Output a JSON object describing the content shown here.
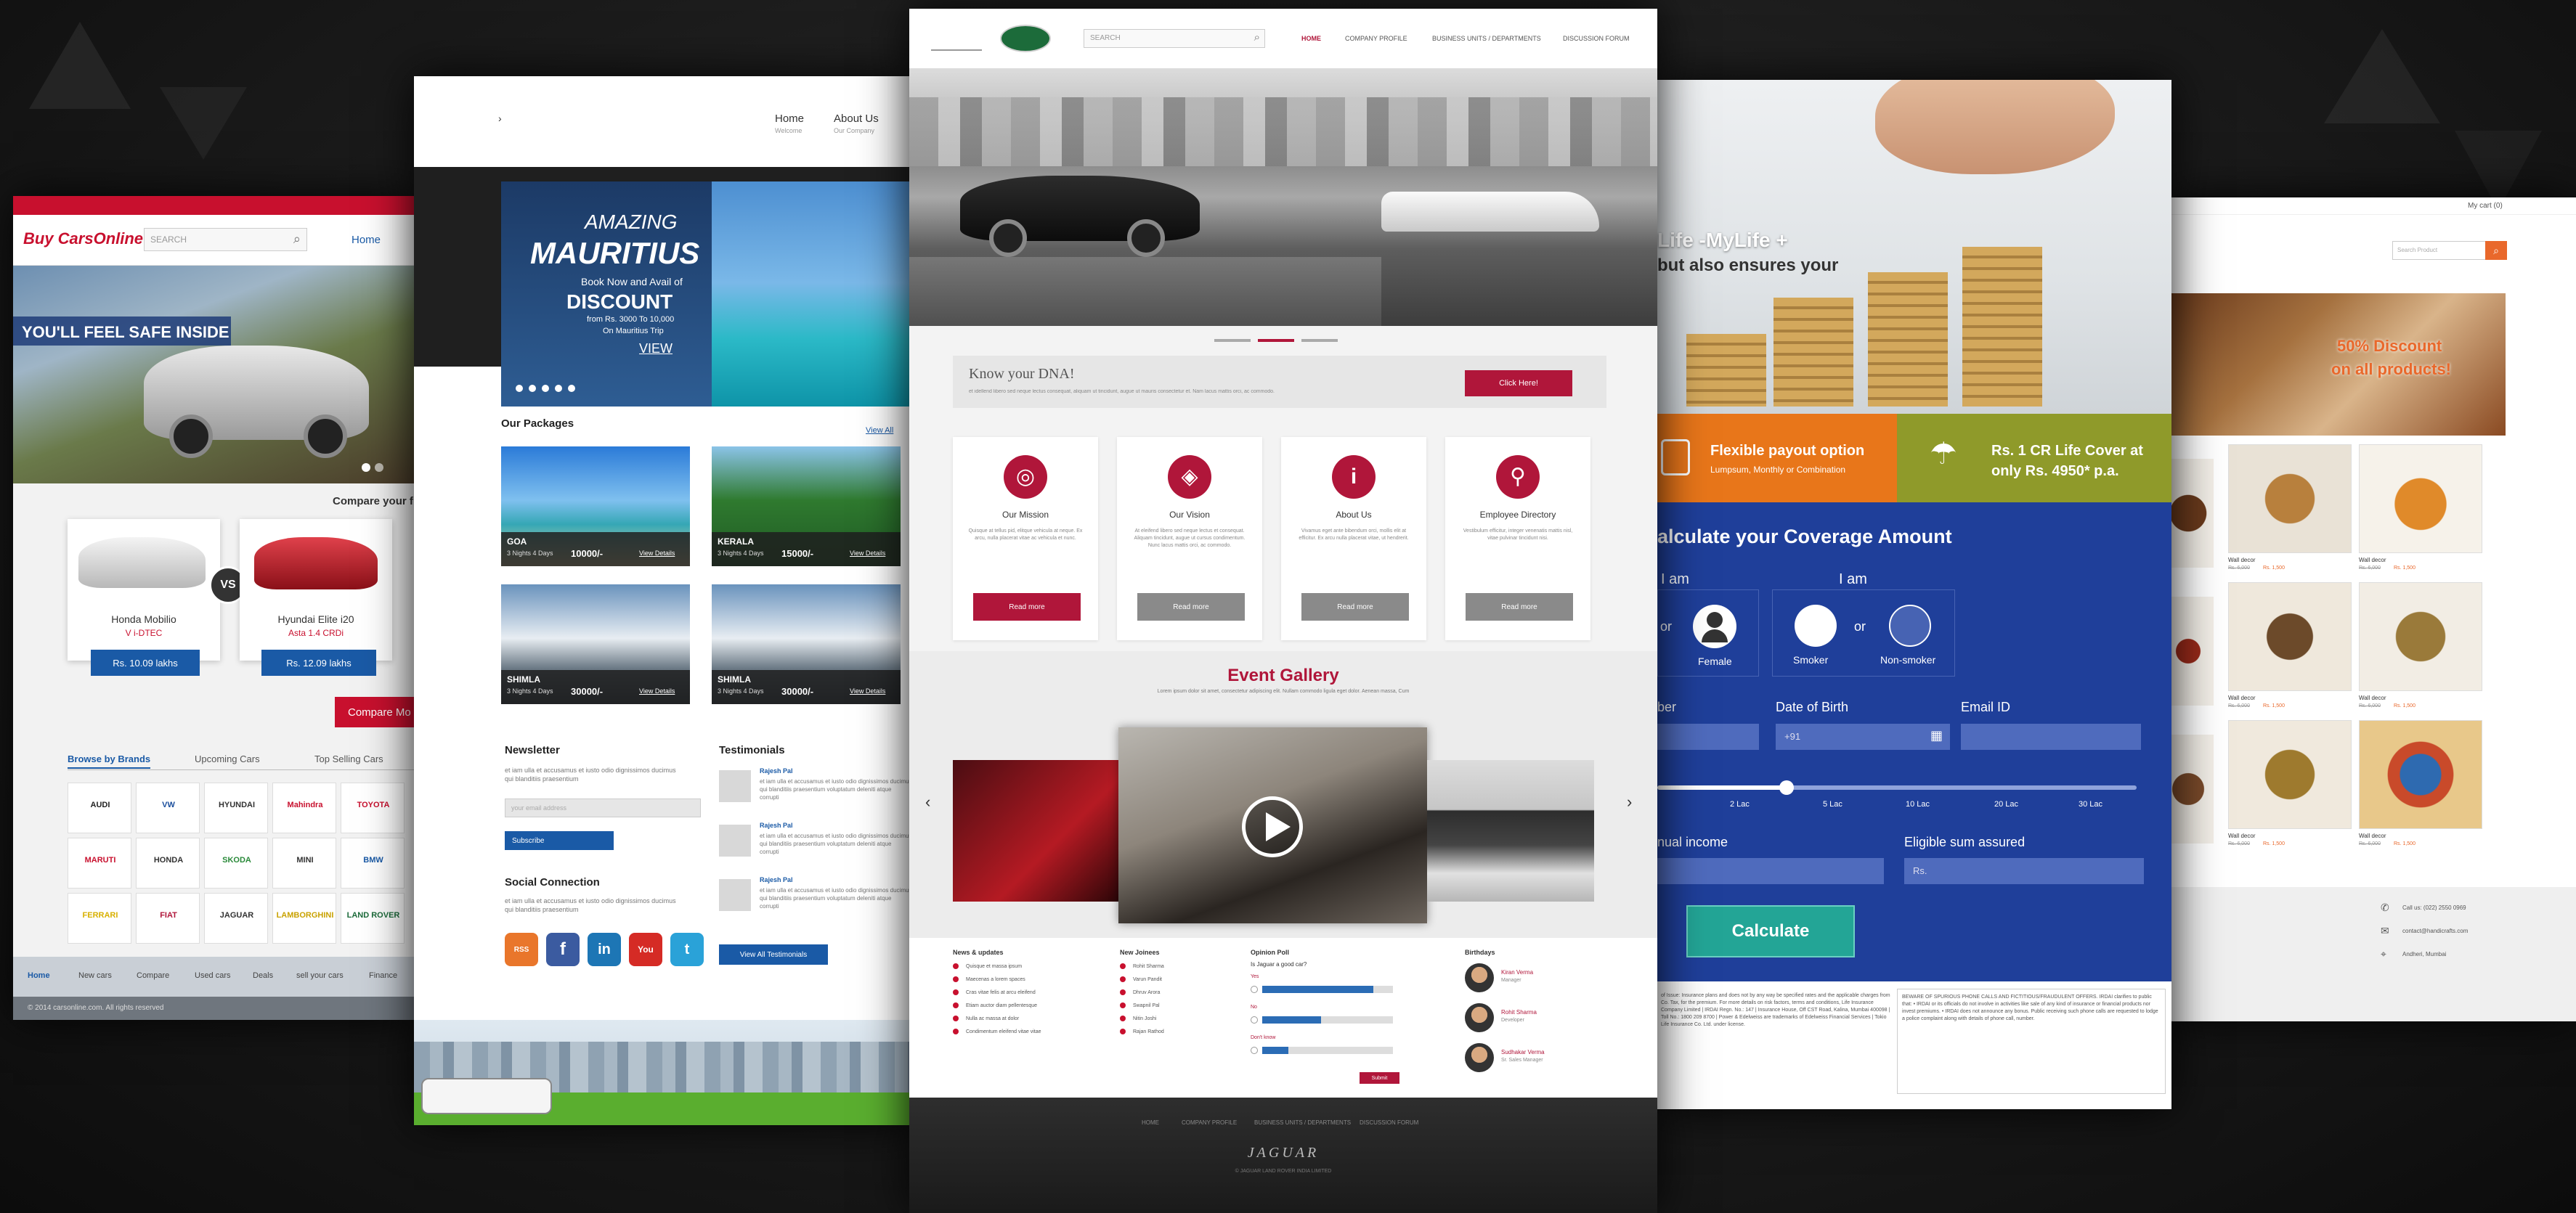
{
  "cars_site": {
    "logo": "Buy CarsOnline",
    "search_placeholder": "SEARCH",
    "nav": [
      "Home"
    ],
    "hero_tagline": "YOU'LL FEEL SAFE INSIDE",
    "compare_heading": "Compare your f",
    "car_a_name": "Honda Mobilio",
    "car_a_variant": "V i-DTEC",
    "car_a_price": "Rs. 10.09 lakhs",
    "car_b_name": "Hyundai Elite i20",
    "car_b_variant": "Asta 1.4 CRDi",
    "car_b_price": "Rs. 12.09 lakhs",
    "vs": "VS",
    "compare_button": "Compare Mo",
    "tabs": [
      "Browse by Brands",
      "Upcoming Cars",
      "Top Selling Cars"
    ],
    "brands": [
      "AUDI",
      "VW",
      "HYUNDAI",
      "Mahindra",
      "TOYOTA",
      "MARUTI",
      "HONDA",
      "SKODA",
      "MINI",
      "BMW",
      "FERRARI",
      "FIAT",
      "JAGUAR",
      "LAMBORGHINI",
      "LAND ROVER"
    ],
    "footer_links": [
      "Home",
      "New cars",
      "Compare",
      "Used cars",
      "Deals",
      "sell your cars",
      "Finance"
    ],
    "copyright": "© 2014 carsonline.com. All rights reserved"
  },
  "holiday_site": {
    "nav": [
      {
        "label": "Home",
        "sub": "Welcome"
      },
      {
        "label": "About Us",
        "sub": "Our Company"
      }
    ],
    "hero_line1": "AMAZING",
    "hero_line2": "MAURITIUS",
    "hero_line3": "Book Now and Avail of",
    "hero_line4": "DISCOUNT",
    "hero_line5": "from Rs. 3000 To 10,000",
    "hero_line6": "On Mauritius Trip",
    "hero_cta": "VIEW",
    "packages_title": "Our Packages",
    "view_all": "View All",
    "packages": [
      {
        "name": "GOA",
        "nights": "3 Nights 4 Days",
        "price": "10000/-",
        "link": "View Details"
      },
      {
        "name": "KERALA",
        "nights": "3 Nights 4 Days",
        "price": "15000/-",
        "link": "View Details"
      },
      {
        "name": "SHIMLA",
        "nights": "3 Nights 4 Days",
        "price": "30000/-",
        "link": "View Details"
      },
      {
        "name": "SHIMLA",
        "nights": "3 Nights 4 Days",
        "price": "30000/-",
        "link": "View Details"
      }
    ],
    "newsletter_title": "Newsletter",
    "newsletter_text": "et iam ulla et accusamus et iusto odio dignissimos ducimus qui blanditiis praesentium",
    "email_placeholder": "your email address",
    "subscribe": "Subscribe",
    "social_title": "Social Connection",
    "social_text": "et iam ulla et accusamus et iusto odio dignissimos ducimus qui blanditiis praesentium",
    "social_icons": [
      "RSS",
      "f",
      "in",
      "You",
      "t"
    ],
    "testimonials_title": "Testimonials",
    "testimonials": [
      {
        "name": "Rajesh Pal",
        "text": "et iam ulla et accusamus et iusto odio dignissimos ducimus qui blanditiis praesentium voluptatum deleniti atque corrupti"
      },
      {
        "name": "Rajesh Pal",
        "text": "et iam ulla et accusamus et iusto odio dignissimos ducimus qui blanditiis praesentium voluptatum deleniti atque corrupti"
      },
      {
        "name": "Rajesh Pal",
        "text": "et iam ulla et accusamus et iusto odio dignissimos ducimus qui blanditiis praesentium voluptatum deleniti atque corrupti"
      }
    ],
    "view_all_testimonials": "View All Testimonials"
  },
  "jaguar_site": {
    "search_placeholder": "SEARCH",
    "nav": [
      "HOME",
      "COMPANY PROFILE",
      "BUSINESS UNITS / DEPARTMENTS",
      "DISCUSSION FORUM"
    ],
    "dna_title": "Know your DNA!",
    "dna_text": "et idellend libero sed neque lectus consequat, aliquam ut tincidunt, augue ut mauris consectetur et. Nam lacus mattis orci, ac commodo.",
    "dna_button": "Click Here!",
    "cards": [
      {
        "title": "Our Mission",
        "text": "Quisque at tellus pid, elitque vehicula at neque. Ex arcu, nulla placerat vitae ac vehicula et nunc.",
        "button": "Read more"
      },
      {
        "title": "Our Vision",
        "text": "At eleifend libero sed neque lectus et consequat. Aliquam tincidunt, augue ut cursus condimentum. Nunc lacus mattis orci, ac commodo.",
        "button": "Read more"
      },
      {
        "title": "About Us",
        "text": "Vivamus eget ante bibendum orci, mollis elit at efficitur. Ex arcu nulla placerat vitae, ut hendrerit.",
        "button": "Read more"
      },
      {
        "title": "Employee Directory",
        "text": "Vestibulum efficitur, integer venenatis mattis nisl, vitae pulvinar tincidunt nisi.",
        "button": "Read more"
      }
    ],
    "gallery_title": "Event Gallery",
    "gallery_text": "Lorem ipsum dolor sit amet, consectetur adipiscing elit. Nullam commodo ligula eget dolor. Aenean massa, Cum",
    "news_title": "News & updates",
    "news_items": [
      "Quisque et massa ipsum",
      "Maecenas a lorem spaces",
      "Cras vitae felis at arcu eleifend",
      "Etiam auctor diam pellentesque",
      "Nulla ac massa at dolor",
      "Condimentum eleifend vitae vitae"
    ],
    "news2_title": "New Joinees",
    "news2_items": [
      "Rohit Sharma",
      "Varun Pandit",
      "Dhruv Arora",
      "Swapnil Pal",
      "Nitin Joshi",
      "Rajan Rathod"
    ],
    "poll_title": "Opinion Poll",
    "poll_question": "Is Jaguar a good car?",
    "poll_options": [
      {
        "label": "Yes",
        "value": 0.85
      },
      {
        "label": "No",
        "value": 0.45
      },
      {
        "label": "Don't know",
        "value": 0.2
      }
    ],
    "poll_submit": "Submit",
    "bday_title": "Birthdays",
    "birthdays": [
      {
        "name": "Kiran Verma",
        "role": "Manager"
      },
      {
        "name": "Rohit Sharma",
        "role": "Developer"
      },
      {
        "name": "Sudhakar Verma",
        "role": "Sr. Sales Manager"
      }
    ],
    "footer_links": [
      "HOME",
      "COMPANY PROFILE",
      "BUSINESS UNITS / DEPARTMENTS",
      "DISCUSSION FORUM"
    ],
    "footer_logo": "JAGUAR",
    "footer_copy": "© JAGUAR LAND ROVER INDIA LIMITED"
  },
  "insurance_site": {
    "hero_line1": "Life -MyLife +",
    "hero_line2": "but also ensures your",
    "feature1_title": "Flexible payout option",
    "feature1_sub": "Lumpsum, Monthly or Combination",
    "feature2_title": "Rs. 1 CR Life Cover at",
    "feature2_sub": "only Rs. 4950* p.a.",
    "calc_title": "alculate your Coverage Amount",
    "i_am_1": "I am",
    "i_am_2": "I am",
    "or": "or",
    "gender_female": "Female",
    "smoker": "Smoker",
    "non_smoker": "Non-smoker",
    "label_number": "ber",
    "label_dob": "Date of Birth",
    "label_email": "Email ID",
    "dob_prefix": "+91",
    "slider_ticks": [
      "2 Lac",
      "5 Lac",
      "10 Lac",
      "20 Lac",
      "30 Lac"
    ],
    "slider_value": 0.27,
    "label_income": "nual income",
    "label_sum": "Eligible sum assured",
    "sum_prefix": "Rs.",
    "calc_button": "Calculate",
    "disclaimer_left": "of Issue: Insurance plans and does not by any way be specified rates and the applicable charges from Co. Tax, for the premium. For more details on risk factors, terms and conditions, Life Insurance Company Limited | IRDAI Regn. No.: 147 | Insurance House, Off CST Road, Kalina, Mumbai 400098 | Toll No.: 1800 209 8700 | Power & Edelweiss are trademarks of Edelweiss Financial Services | Tokio Life Insurance Co. Ltd. under license.",
    "disclaimer_right": "BEWARE OF SPURIOUS PHONE CALLS AND FICTITIOUS/FRAUDULENT OFFERS. IRDAI clarifies to public that: • IRDAI or its officials do not involve in activities like sale of any kind of insurance or financial products nor invest premiums. • IRDAI does not announce any bonus. Public receiving such phone calls are requested to lodge a police complaint along with details of phone call, number."
  },
  "crafts_site": {
    "top_link": "My cart (0)",
    "search_placeholder": "Search Product",
    "banner_line1": "50% Discount",
    "banner_line2": "on all products!",
    "products": [
      {
        "name": "Wall decor",
        "price": "Rs. 6,000",
        "sale": "Rs. 1,500"
      },
      {
        "name": "Wall decor",
        "price": "Rs. 6,000",
        "sale": "Rs. 1,500"
      },
      {
        "name": "Wall decor",
        "price": "Rs. 6,000",
        "sale": "Rs. 1,500"
      },
      {
        "name": "Wall decor",
        "price": "Rs. 6,000",
        "sale": "Rs. 1,500"
      },
      {
        "name": "Wall decor",
        "price": "Rs. 6,000",
        "sale": "Rs. 1,500"
      },
      {
        "name": "Wall decor",
        "price": "Rs. 6,000",
        "sale": "Rs. 1,500"
      }
    ],
    "contact_phone": "Call us: (022) 2550 0969",
    "contact_email": "contact@handicrafts.com",
    "contact_location": "Andheri, Mumbai"
  },
  "colors": {
    "jaguar_red": "#b0163a",
    "insurance_blue": "#1f3f9a",
    "insurance_orange": "#e8761a",
    "insurance_olive": "#8f9a2a",
    "crafts_orange": "#e9682b",
    "cars_red": "#c8102e"
  }
}
